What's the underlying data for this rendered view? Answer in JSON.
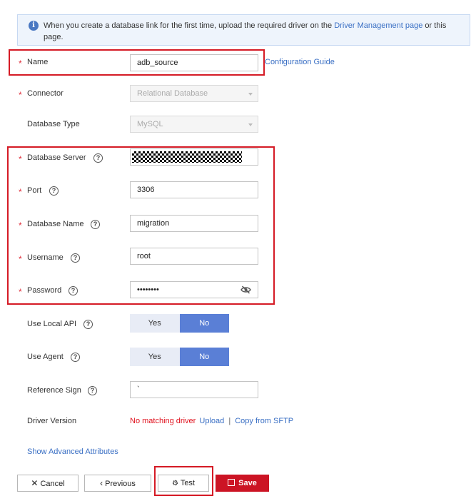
{
  "banner": {
    "text_before": "When you create a database link for the first time, upload the required driver on the ",
    "link": "Driver Management page",
    "text_after": " or this page."
  },
  "form": {
    "name": {
      "label": "Name",
      "value": "adb_source",
      "guide_link": "Configuration Guide"
    },
    "connector": {
      "label": "Connector",
      "value": "Relational Database"
    },
    "database_type": {
      "label": "Database Type",
      "value": "MySQL"
    },
    "database_server": {
      "label": "Database Server"
    },
    "port": {
      "label": "Port",
      "value": "3306"
    },
    "database_name": {
      "label": "Database Name",
      "value": "migration"
    },
    "username": {
      "label": "Username",
      "value": "root"
    },
    "password": {
      "label": "Password",
      "value": "••••••••"
    },
    "use_local_api": {
      "label": "Use Local API",
      "yes": "Yes",
      "no": "No",
      "selected": "No"
    },
    "use_agent": {
      "label": "Use Agent",
      "yes": "Yes",
      "no": "No",
      "selected": "No"
    },
    "reference_sign": {
      "label": "Reference Sign",
      "value": "`"
    },
    "driver_version": {
      "label": "Driver Version",
      "status": "No matching driver",
      "upload": "Upload",
      "separator": "|",
      "copy_from_sftp": "Copy from SFTP"
    },
    "advanced_link": "Show Advanced Attributes",
    "required_mark": "*",
    "help_mark": "?"
  },
  "actions": {
    "cancel": "Cancel",
    "previous": "Previous",
    "test": "Test",
    "save": "Save"
  },
  "colors": {
    "required": "#e0303c",
    "link": "#3a6fc4",
    "highlight": "#d51a25",
    "toggle_selected": "#5a7fd6",
    "save": "#cc1424",
    "error_text": "#e0101c"
  }
}
